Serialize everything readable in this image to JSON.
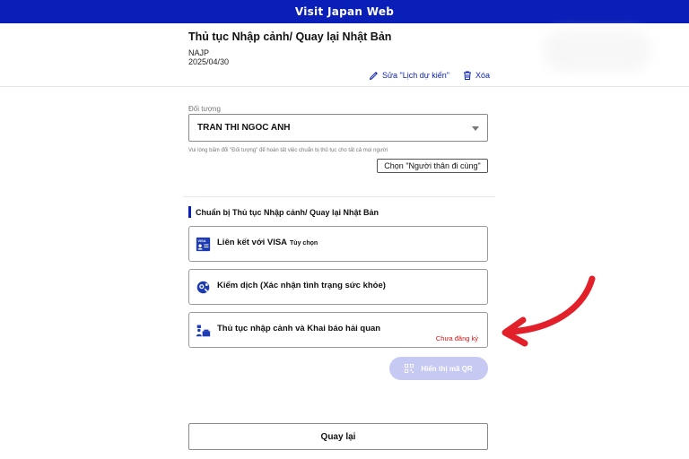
{
  "app": {
    "title": "Visit Japan Web"
  },
  "header": {
    "title": "Thủ tục Nhập cảnh/ Quay lại Nhật Bản",
    "code": "NAJP",
    "date": "2025/04/30",
    "edit_label": "Sửa \"Lịch dự kiến\"",
    "delete_label": "Xóa"
  },
  "subject": {
    "label": "Đối tượng",
    "selected": "TRAN THI NGOC ANH",
    "hint": "Vui lòng bấm đổi \"Đối tượng\" để hoàn tất việc chuẩn bị thủ tục cho tất cả mọi người",
    "companion_button": "Chọn \"Người thân đi cùng\""
  },
  "section": {
    "title": "Chuẩn bị Thủ tục Nhập cảnh/ Quay lại Nhật Bản"
  },
  "cards": [
    {
      "label": "Liên kết với VISA",
      "optional": "Tùy chọn",
      "icon": "visa-icon"
    },
    {
      "label": "Kiểm dịch (Xác nhận tình trạng sức khỏe)",
      "icon": "quarantine-icon"
    },
    {
      "label": "Thủ tục nhập cảnh và Khai báo hải quan",
      "status": "Chưa đăng ký",
      "icon": "immigration-officer-icon"
    }
  ],
  "qr_button": {
    "label": "Hiển thị mã QR",
    "icon": "qr-code-icon"
  },
  "back_button": {
    "label": "Quay lại"
  },
  "colors": {
    "brand": "#0a1fb8",
    "status_red": "#d01414",
    "annotation_arrow": "#e2202a",
    "qr_disabled": "#c6c9f1"
  }
}
